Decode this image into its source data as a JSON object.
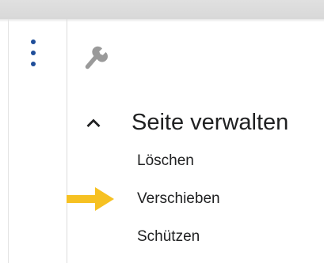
{
  "rail": {
    "more_icon": "kebab-vertical-icon",
    "tools_icon": "wrench-icon"
  },
  "section": {
    "title": "Seite verwalten",
    "toggle_icon": "chevron-up-icon",
    "items": [
      {
        "label": "Löschen"
      },
      {
        "label": "Verschieben"
      },
      {
        "label": "Schützen"
      }
    ]
  },
  "highlight": {
    "icon": "arrow-right-icon",
    "color": "#f6c122",
    "points_to": "Verschieben"
  },
  "colors": {
    "accent": "#1f4e99",
    "text": "#202122"
  }
}
